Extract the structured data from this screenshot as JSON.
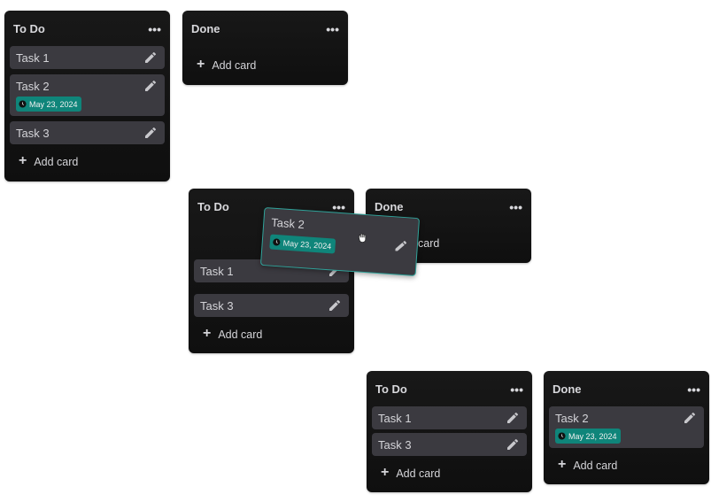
{
  "colors": {
    "list_bg": "#121212",
    "card_bg": "#3b3a40",
    "badge_bg": "#0f857a",
    "drag_border": "#2fa39a",
    "text": "#d4d4d8"
  },
  "frame1": {
    "todo": {
      "title": "To Do",
      "menu": "•••",
      "cards": [
        {
          "title": "Task 1"
        },
        {
          "title": "Task 2",
          "due": "May 23, 2024"
        },
        {
          "title": "Task 3"
        }
      ],
      "add_label": "Add card"
    },
    "done": {
      "title": "Done",
      "menu": "•••",
      "add_label": "Add card"
    }
  },
  "frame2": {
    "todo": {
      "title": "To Do",
      "menu": "•••",
      "cards": [
        {
          "title": "Task 1"
        },
        {
          "title": "Task 3"
        }
      ],
      "add_label": "Add card"
    },
    "done": {
      "title": "Done",
      "menu": "•••",
      "add_label": "Add card"
    },
    "dragging": {
      "title": "Task 2",
      "due": "May 23, 2024"
    }
  },
  "frame3": {
    "todo": {
      "title": "To Do",
      "menu": "•••",
      "cards": [
        {
          "title": "Task 1"
        },
        {
          "title": "Task 3"
        }
      ],
      "add_label": "Add card"
    },
    "done": {
      "title": "Done",
      "menu": "•••",
      "cards": [
        {
          "title": "Task 2",
          "due": "May 23, 2024"
        }
      ],
      "add_label": "Add card"
    }
  },
  "icons": {
    "edit": "pencil-icon",
    "add": "plus-icon",
    "due": "clock-icon",
    "menu": "more-options-icon",
    "cursor": "grab-hand-icon"
  }
}
